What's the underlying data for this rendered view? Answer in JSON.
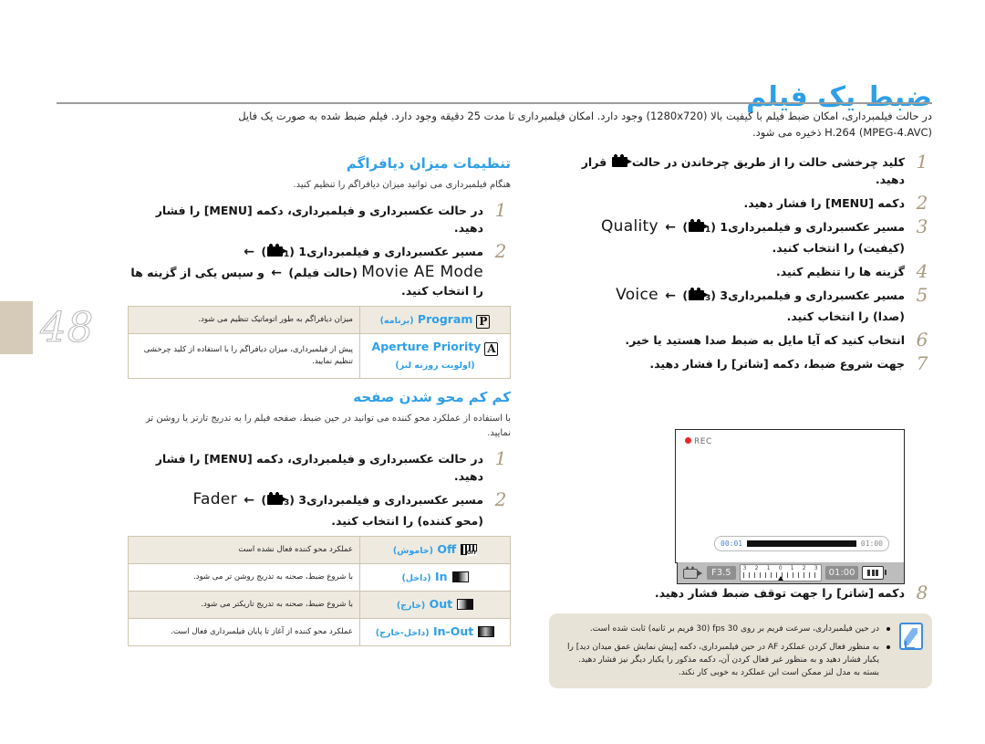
{
  "page": {
    "number": "48",
    "title": "ضبط یک فیلم",
    "intro_line1": "در حالت فیلمبرداری، امکان ضبط فیلم با کیفیت بالا (1280x720) وجود دارد. امکان فیلمبرداری تا مدت 25 دقیقه وجود دارد. فیلم ضبط شده به صورت یک فایل",
    "intro_line2": "H.264 (MPEG-4.AVC) ذخیره می شود."
  },
  "right_column": {
    "steps": [
      {
        "num": "1",
        "text_before": "کلید چرخشی حالت را از طریق چرخاندن در حالت",
        "icon": "camcorder-icon",
        "text_after": "قرار دهید."
      },
      {
        "num": "2",
        "text": "دکمه [MENU] را فشار دهید."
      },
      {
        "num": "3",
        "path_fa": "مسیر عکسبرداری و فیلمبرداری",
        "path_idx": "1",
        "icon": "camcorder-icon",
        "arrow": "←",
        "target_en": "Quality",
        "text_after": "(کیفیت) را انتخاب کنید."
      },
      {
        "num": "4",
        "text": "گزینه ها را تنظیم کنید."
      },
      {
        "num": "5",
        "path_fa": "مسیر عکسبرداری و فیلمبرداری",
        "path_idx": "3",
        "icon": "camcorder-icon",
        "arrow": "←",
        "target_en": "Voice",
        "text_after": "(صدا) را انتخاب کنید."
      },
      {
        "num": "6",
        "text": "انتخاب کنید که آیا مایل به ضبط صدا هستید یا خیر."
      },
      {
        "num": "7",
        "text": "جهت شروع ضبط، دکمه [شاتر] را فشار دهید."
      },
      {
        "num": "8",
        "text": "دکمه [شاتر] را جهت توقف ضبط فشار دهید."
      }
    ],
    "lcd": {
      "rec_label": "REC",
      "time_elapsed": "00:01",
      "time_total": "01:00",
      "aperture": "F3.5",
      "ev_scale": [
        "3",
        "2",
        "1",
        "0",
        "1",
        "2",
        "3"
      ],
      "remaining": "01:00",
      "battery": "battery-full-icon"
    },
    "note": {
      "icon": "note-pencil-icon",
      "items": [
        "در حین فیلمبرداری، سرعت فریم بر روی 30 fps (30 فریم بر ثانیه) ثابت شده است.",
        "به منظور فعال کردن عملکرد AF در حین فیلمبرداری، دکمه [پیش نمایش عمق میدان دید] را یکبار فشار دهید و به منظور غیر فعال کردن آن، دکمه مذکور را یکبار دیگر نیز فشار دهید. بسته به مدل لنز ممکن است این عملکرد به خوبی کار نکند."
      ]
    }
  },
  "left_column": {
    "section1": {
      "heading": "تنظیمات میزان دیافراگم",
      "subtext": "هنگام فیلمبرداری می توانید میزان دیافراگم را تنظیم کنید.",
      "steps": [
        {
          "num": "1",
          "text": "در حالت عکسبرداری و فیلمبرداری، دکمه [MENU] را فشار دهید."
        },
        {
          "num": "2",
          "path_fa": "مسیر عکسبرداری و فیلمبرداری",
          "path_idx": "1",
          "icon": "camcorder-icon",
          "arrow": "←"
        },
        {
          "num": "",
          "target_en": "Movie AE Mode",
          "target_fa": "(حالت فیلم)",
          "arrow": "←",
          "text_after": "و سپس یکی از گزینه ها را انتخاب کنید."
        }
      ],
      "table": {
        "rows": [
          {
            "icon": "program-mode-icon",
            "icon_glyph": "P",
            "name_en": "Program",
            "name_fa": "(برنامه)",
            "desc": "میزان دیافراگم به طور اتوماتیک تنظیم می شود."
          },
          {
            "icon": "aperture-priority-icon",
            "icon_glyph": "A",
            "name_en": "Aperture Priority",
            "name_fa": "(اولویت روزنه لنز)",
            "desc": "پیش از فیلمبرداری، میزان دیافراگم را با استفاده از کلید چرخشی تنظیم نمایید."
          }
        ]
      }
    },
    "section2": {
      "heading": "کم کم محو شدن صفحه",
      "subtext": "با استفاده از عملکرد محو کننده می توانید در حین ضبط، صفحه فیلم را به تدریج تارتر یا روشن تر نمایید.",
      "steps": [
        {
          "num": "1",
          "text": "در حالت عکسبرداری و فیلمبرداری، دکمه [MENU] را فشار دهید."
        },
        {
          "num": "2",
          "path_fa": "مسیر عکسبرداری و فیلمبرداری",
          "path_idx": "3",
          "icon": "camcorder-icon",
          "arrow": "←",
          "target_en": "Fader",
          "text_after": "(محو کننده) را انتخاب کنید."
        }
      ],
      "table": {
        "rows": [
          {
            "icon": "fader-off-icon",
            "name_en": "Off",
            "name_fa": "(خاموش)",
            "desc": "عملکرد محو کننده فعال نشده است"
          },
          {
            "icon": "fader-in-icon",
            "name_en": "In",
            "name_fa": "(داخل)",
            "desc": "با شروع ضبط، صحنه به تدریج روشن تر می شود."
          },
          {
            "icon": "fader-out-icon",
            "name_en": "Out",
            "name_fa": "(خارج)",
            "desc": "با شروع ضبط، صحنه به تدریج تاریکتر می شود."
          },
          {
            "icon": "fader-in-out-icon",
            "name_en": "In-Out",
            "name_fa": "(داخل-خارج)",
            "desc": "عملکرد محو کننده از آغاز تا پایان فیلمبرداری فعال است."
          }
        ]
      }
    }
  }
}
